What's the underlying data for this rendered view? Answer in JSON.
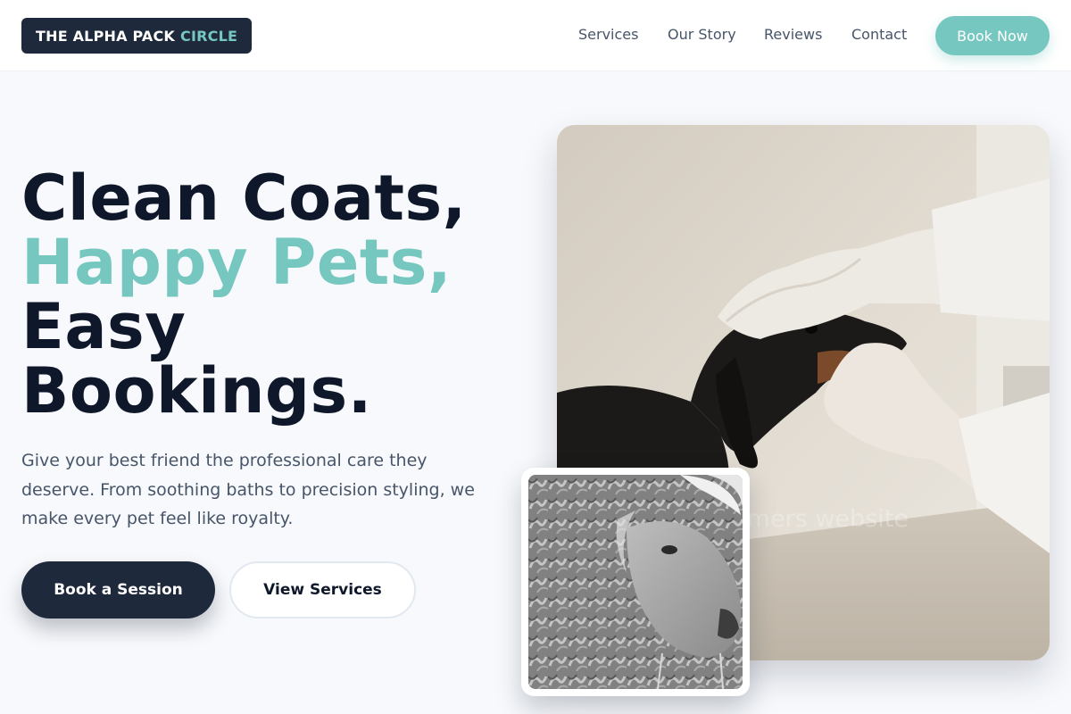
{
  "brand": {
    "part1": "THE ALPHA PACK",
    "part2": "CIRCLE"
  },
  "nav": {
    "items": [
      {
        "label": "Services"
      },
      {
        "label": "Our Story"
      },
      {
        "label": "Reviews"
      },
      {
        "label": "Contact"
      }
    ],
    "cta": "Book Now"
  },
  "hero": {
    "line1": "Clean Coats,",
    "line2": "Happy Pets,",
    "line3": "Easy",
    "line4": "Bookings.",
    "lead": "Give your best friend the professional care they deserve. From soothing baths to precision styling, we make every pet feel like royalty.",
    "primary_cta": "Book a Session",
    "secondary_cta": "View Services"
  },
  "images": {
    "main_watermark": "groomers website"
  },
  "colors": {
    "accent": "#76c7c0",
    "dark": "#1e293b",
    "text": "#0f172a",
    "muted": "#475569",
    "background": "#f7f9fc"
  }
}
